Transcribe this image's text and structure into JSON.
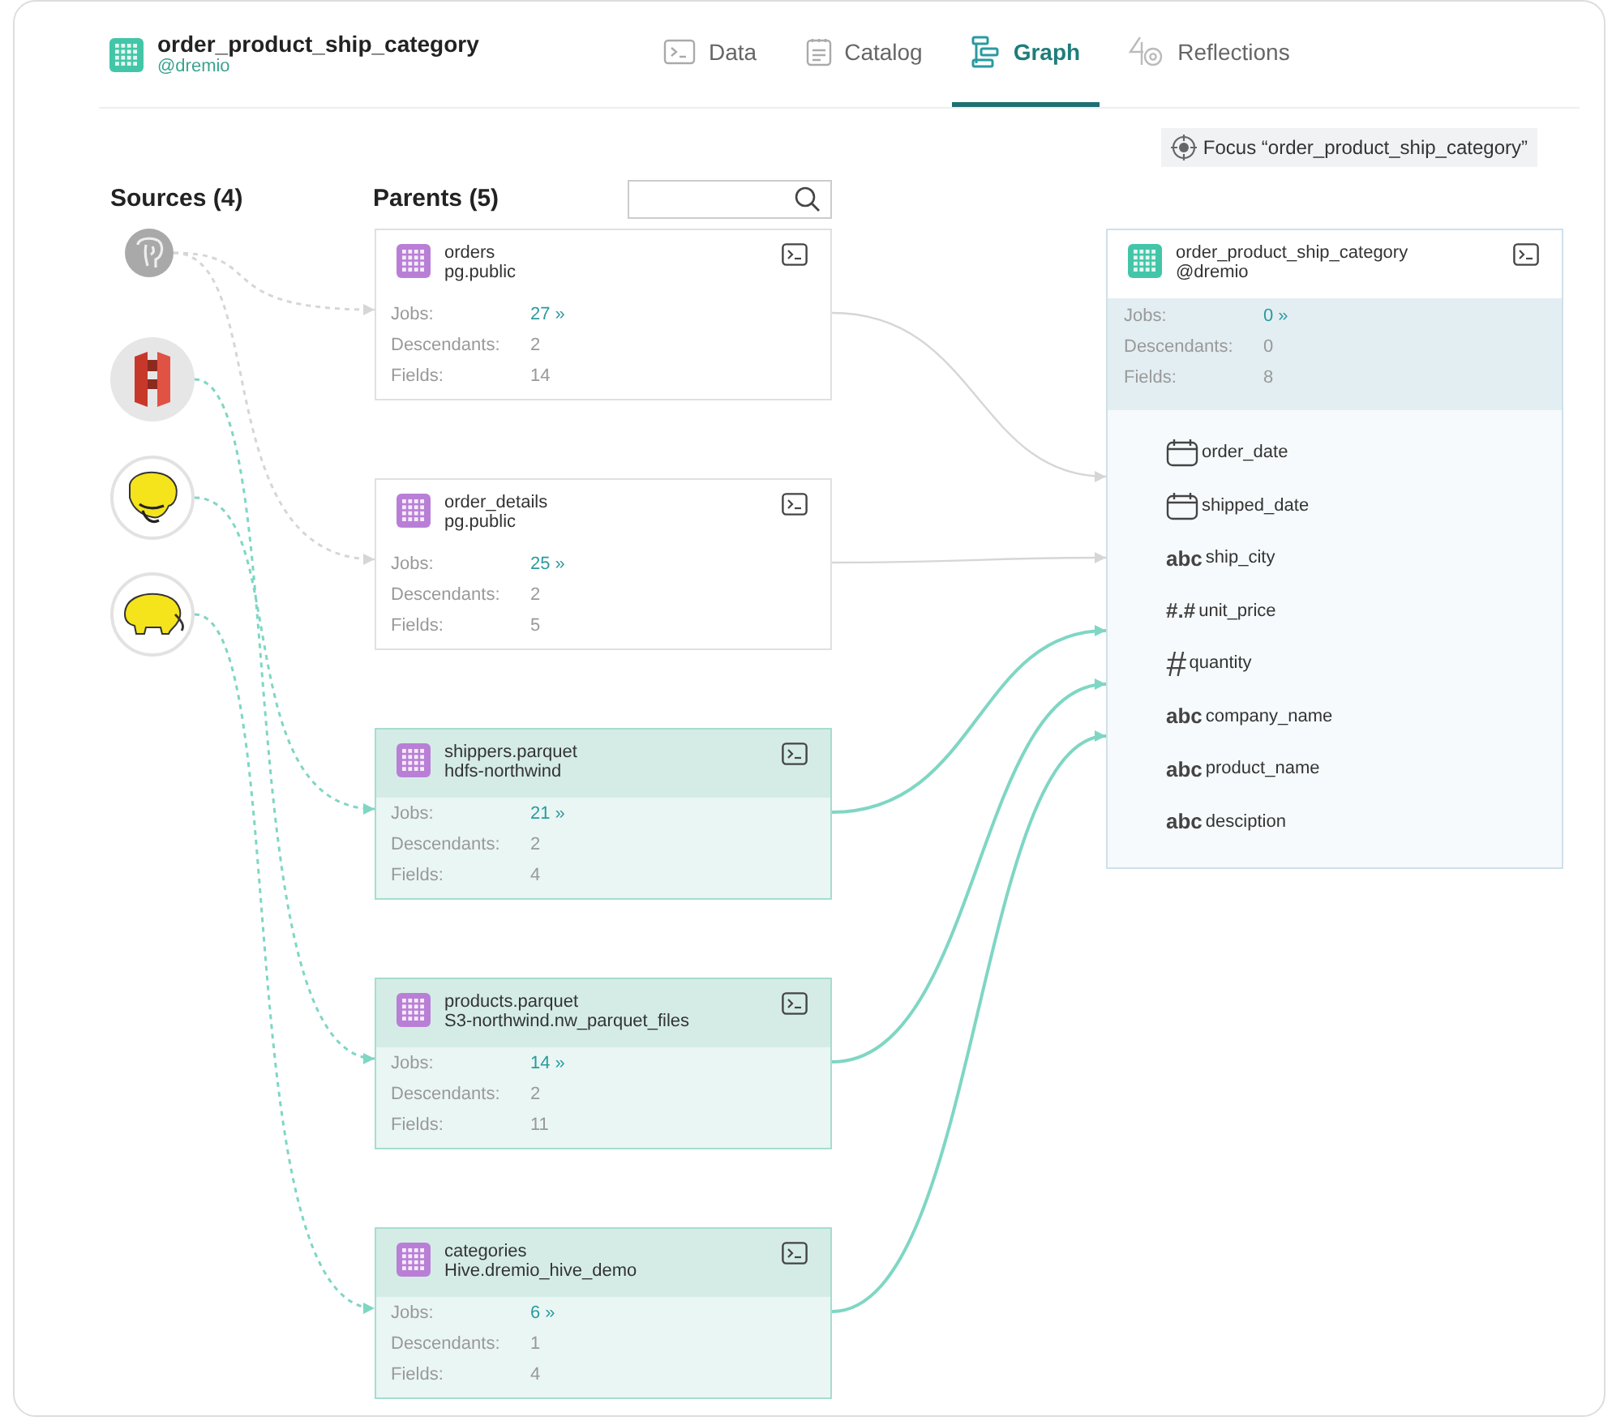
{
  "dataset": {
    "title": "order_product_ship_category",
    "space": "@dremio"
  },
  "tabs": [
    {
      "kind": "data",
      "label": "Data",
      "selected": false
    },
    {
      "kind": "catalog",
      "label": "Catalog",
      "selected": false
    },
    {
      "kind": "graph",
      "label": "Graph",
      "selected": true
    },
    {
      "kind": "reflections",
      "label": "Reflections",
      "selected": false
    }
  ],
  "focus_button": "Focus “order_product_ship_category”",
  "sources_heading": "Sources (4)",
  "parents_heading": "Parents (5)",
  "sources": [
    {
      "kind": "postgres",
      "highlighted": false
    },
    {
      "kind": "s3",
      "highlighted": true
    },
    {
      "kind": "hdfs",
      "highlighted": true
    },
    {
      "kind": "hive",
      "highlighted": true
    }
  ],
  "parents": [
    {
      "name": "orders",
      "path": "pg.public",
      "highlighted": false,
      "stats": [
        {
          "kind": "jobs",
          "label": "Jobs:",
          "value": "27 »"
        },
        {
          "kind": "count",
          "label": "Descendants:",
          "value": "2"
        },
        {
          "kind": "count",
          "label": "Fields:",
          "value": "14"
        }
      ]
    },
    {
      "name": "order_details",
      "path": "pg.public",
      "highlighted": false,
      "stats": [
        {
          "kind": "jobs",
          "label": "Jobs:",
          "value": "25 »"
        },
        {
          "kind": "count",
          "label": "Descendants:",
          "value": "2"
        },
        {
          "kind": "count",
          "label": "Fields:",
          "value": "5"
        }
      ]
    },
    {
      "name": "shippers.parquet",
      "path": "hdfs-northwind",
      "highlighted": true,
      "stats": [
        {
          "kind": "jobs",
          "label": "Jobs:",
          "value": "21 »"
        },
        {
          "kind": "count",
          "label": "Descendants:",
          "value": "2"
        },
        {
          "kind": "count",
          "label": "Fields:",
          "value": "4"
        }
      ]
    },
    {
      "name": "products.parquet",
      "path": "S3-northwind.nw_parquet_files",
      "highlighted": true,
      "stats": [
        {
          "kind": "jobs",
          "label": "Jobs:",
          "value": "14 »"
        },
        {
          "kind": "count",
          "label": "Descendants:",
          "value": "2"
        },
        {
          "kind": "count",
          "label": "Fields:",
          "value": "11"
        }
      ]
    },
    {
      "name": "categories",
      "path": "Hive.dremio_hive_demo",
      "highlighted": true,
      "stats": [
        {
          "kind": "jobs",
          "label": "Jobs:",
          "value": "6 »"
        },
        {
          "kind": "count",
          "label": "Descendants:",
          "value": "1"
        },
        {
          "kind": "count",
          "label": "Fields:",
          "value": "4"
        }
      ]
    }
  ],
  "current": {
    "name": "order_product_ship_category",
    "path": "@dremio",
    "stats": [
      {
        "kind": "jobs",
        "label": "Jobs:",
        "value": "0 »"
      },
      {
        "kind": "count",
        "label": "Descendants:",
        "value": "0"
      },
      {
        "kind": "count",
        "label": "Fields:",
        "value": "8"
      }
    ],
    "columns": [
      {
        "kind": "date",
        "name": "order_date"
      },
      {
        "kind": "date",
        "name": "shipped_date"
      },
      {
        "kind": "text",
        "type_label": "abc",
        "name": "ship_city"
      },
      {
        "kind": "decimal",
        "type_label": "#.#",
        "name": "unit_price"
      },
      {
        "kind": "integer",
        "type_label": "#",
        "name": "quantity"
      },
      {
        "kind": "text",
        "type_label": "abc",
        "name": "company_name"
      },
      {
        "kind": "text",
        "type_label": "abc",
        "name": "product_name"
      },
      {
        "kind": "text",
        "type_label": "abc",
        "name": "desciption"
      }
    ]
  }
}
